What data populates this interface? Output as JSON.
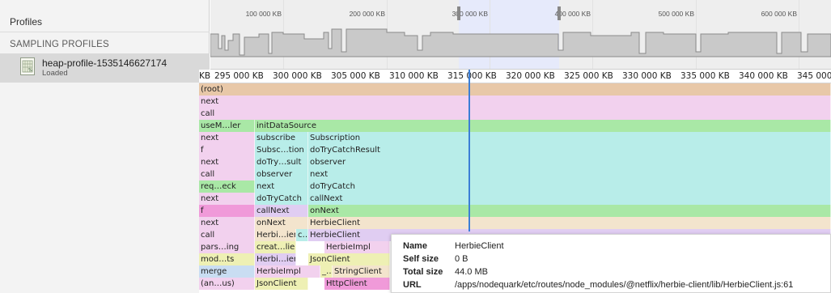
{
  "sidebar": {
    "title": "Profiles",
    "section_label": "SAMPLING PROFILES",
    "profile": {
      "name": "heap-profile-1535146627174",
      "status": "Loaded",
      "icon": "heap-profile-icon"
    }
  },
  "overview": {
    "labels": [
      "100 000 KB",
      "200 000 KB",
      "300 000 KB",
      "400 000 KB",
      "500 000 KB",
      "600 000 KB"
    ]
  },
  "ruler": {
    "labels": [
      "KB",
      "295 000 KB",
      "300 000 KB",
      "305 000 KB",
      "310 000 KB",
      "315 000 KB",
      "320 000 KB",
      "325 000 KB",
      "330 000 KB",
      "335 000 KB",
      "340 000 KB",
      "345 000 KB"
    ]
  },
  "flame_rows": [
    [
      "(root)"
    ],
    [
      "next"
    ],
    [
      "call"
    ],
    [
      "useM…ler",
      "initDataSource"
    ],
    [
      "next",
      "subscribe",
      "Subscription"
    ],
    [
      "f",
      "Subsc…tion",
      "doTryCatchResult"
    ],
    [
      "next",
      "doTry…sult",
      "observer"
    ],
    [
      "call",
      "observer",
      "next"
    ],
    [
      "req…eck",
      "next",
      "doTryCatch"
    ],
    [
      "next",
      "doTryCatch",
      "callNext"
    ],
    [
      "f",
      "callNext",
      "onNext"
    ],
    [
      "next",
      "onNext",
      "HerbieClient"
    ],
    [
      "call",
      "Herbi…ient",
      "c…",
      "HerbieClient"
    ],
    [
      "pars…ing",
      "creat…lient",
      "HerbieImpl"
    ],
    [
      "mod…ts",
      "Herbi…ient",
      "JsonClient"
    ],
    [
      "merge",
      "HerbieImpl",
      "_…",
      "StringClient"
    ],
    [
      "(an…us)",
      "JsonClient",
      "HttpClient"
    ]
  ],
  "tooltip": {
    "rows": [
      {
        "key": "Name",
        "value": "HerbieClient"
      },
      {
        "key": "Self size",
        "value": "0 B"
      },
      {
        "key": "Total size",
        "value": "44.0 MB"
      },
      {
        "key": "URL",
        "value": "/apps/nodequark/etc/routes/node_modules/@netflix/herbie-client/lib/HerbieClient.js:61"
      }
    ]
  },
  "colors": {
    "root": "#e8c8a8",
    "pink": "#f2d1ee",
    "green": "#a9e8a6",
    "cyan": "#b8ede9",
    "orange": "#f3e4cd",
    "purple": "#e0cdf2",
    "yellow": "#eef0b4",
    "magenta": "#f09ad9",
    "blue": "#c9ddf2",
    "selection": "#3b7ed6"
  }
}
